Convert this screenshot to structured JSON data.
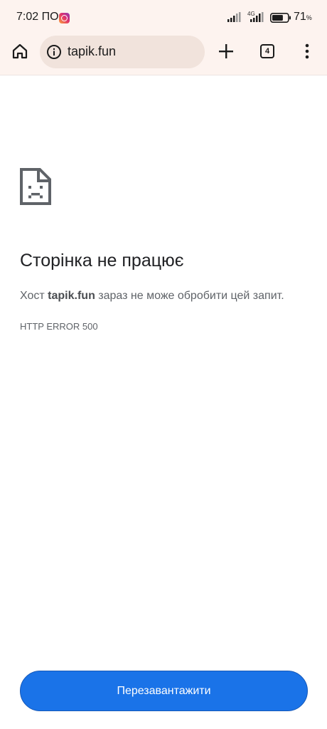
{
  "status_bar": {
    "time": "7:02 ПО",
    "network_type": "4G",
    "battery_percent": "71",
    "battery_unit": "%",
    "battery_level": 0.71
  },
  "toolbar": {
    "url": "tapik.fun",
    "tab_count": "4",
    "icons": {
      "home": "home-icon",
      "info": "info-icon",
      "new_tab": "plus-icon",
      "tabs": "tab-switcher-icon",
      "menu": "more-vert-icon"
    }
  },
  "page": {
    "title": "Сторінка не працює",
    "description_prefix": "Хост ",
    "description_host": "tapik.fun",
    "description_suffix": " зараз не може обробити цей запит.",
    "error_code": "HTTP ERROR 500",
    "reload_label": "Перезавантажити",
    "icon": "sad-page-icon"
  },
  "colors": {
    "chrome_bg": "#fdf3ef",
    "omnibox_bg": "#f1e3dc",
    "accent": "#1a73e8"
  }
}
